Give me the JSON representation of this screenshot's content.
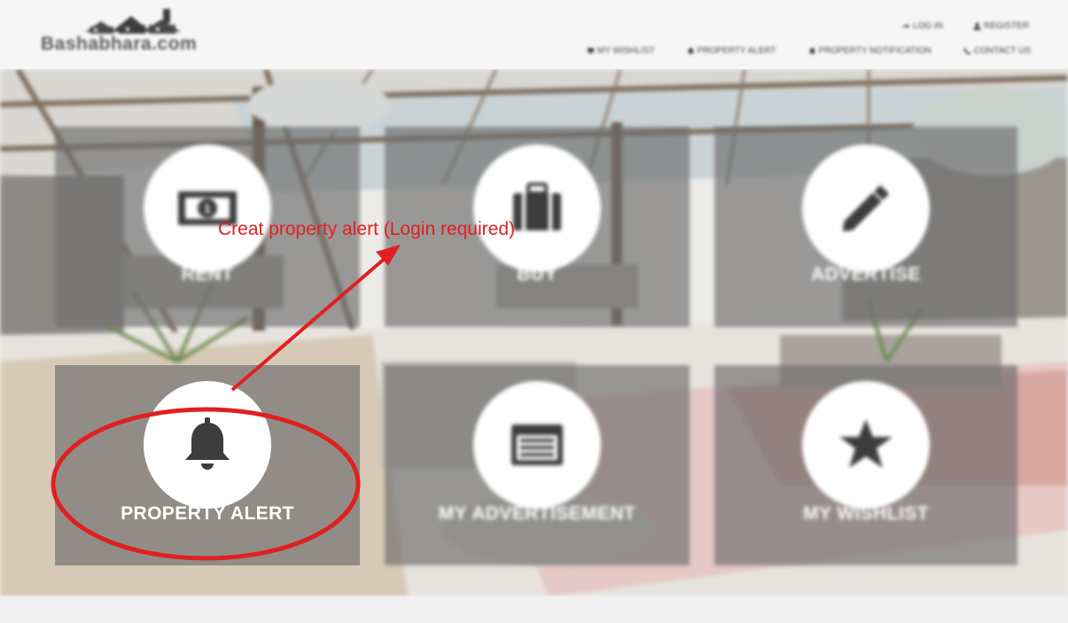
{
  "site": {
    "logo_text": "Bashabhara.com"
  },
  "nav": {
    "top": [
      {
        "label": "LOG IN",
        "icon": "login-icon"
      },
      {
        "label": "REGISTER",
        "icon": "user-icon"
      }
    ],
    "main": [
      {
        "label": "MY WISHLIST",
        "icon": "heart-icon"
      },
      {
        "label": "PROPERTY ALERT",
        "icon": "bell-icon"
      },
      {
        "label": "PROPERTY NOTIFICATION",
        "icon": "bell-icon"
      },
      {
        "label": "CONTACT US",
        "icon": "phone-icon"
      }
    ]
  },
  "tiles": [
    {
      "label": "RENT",
      "icon": "money-bill-icon"
    },
    {
      "label": "BUY",
      "icon": "briefcase-icon"
    },
    {
      "label": "ADVERTISE",
      "icon": "pencil-icon"
    },
    {
      "label": "PROPERTY ALERT",
      "icon": "bell-icon"
    },
    {
      "label": "MY ADVERTISEMENT",
      "icon": "list-window-icon"
    },
    {
      "label": "MY WISHLIST",
      "icon": "star-icon"
    }
  ],
  "annotation": {
    "text": "Creat property alert (Login required)",
    "color": "#e02020"
  },
  "colors": {
    "tile_overlay": "#6e6e6e",
    "tile_icon": "#3d3d3d",
    "annotation_red": "#e02020"
  }
}
